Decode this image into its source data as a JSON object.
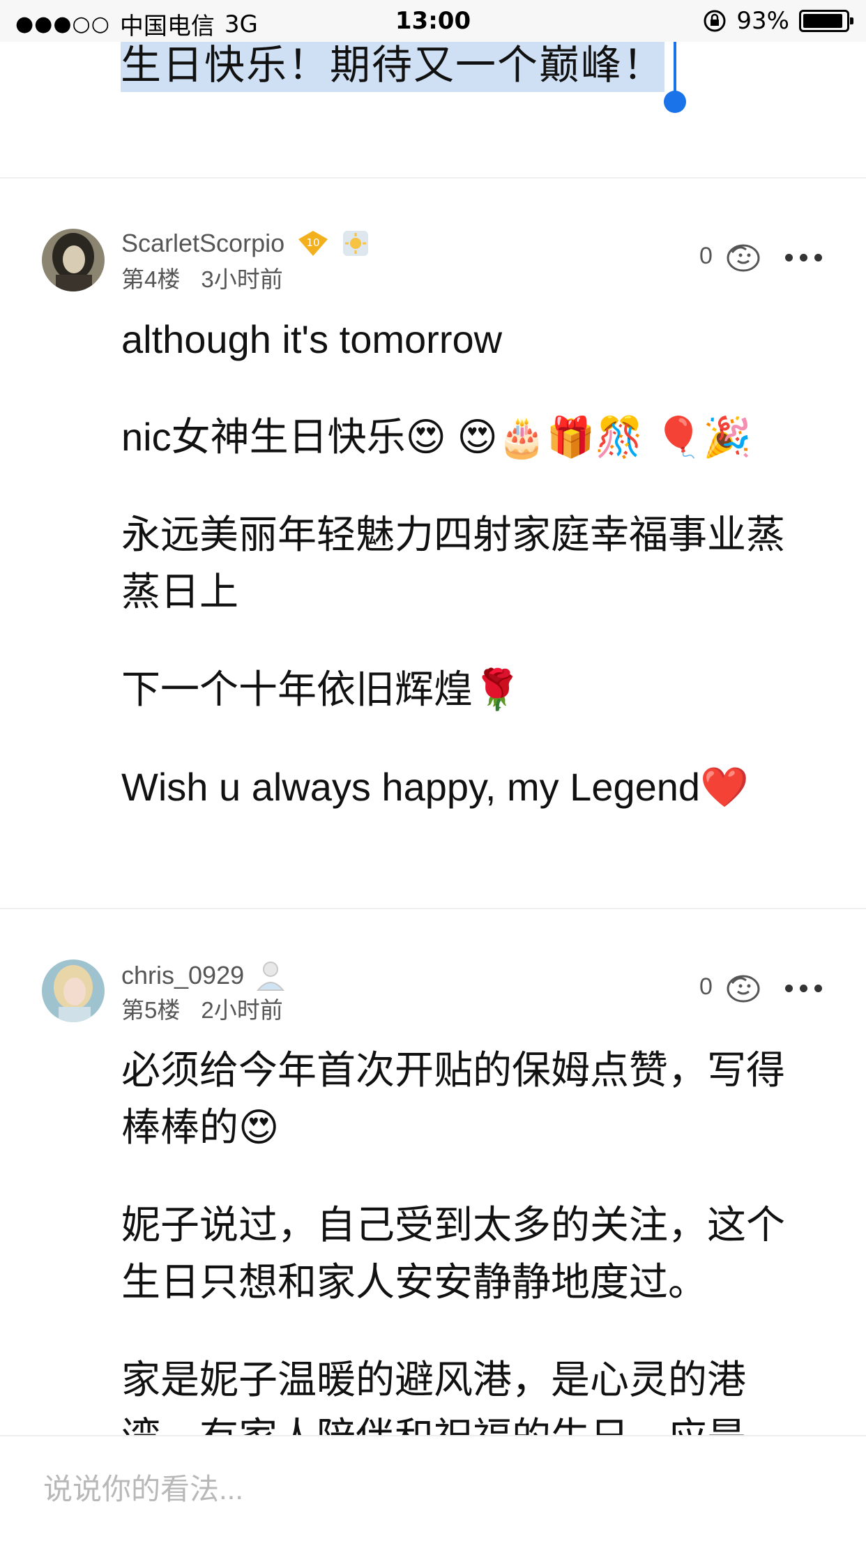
{
  "status_bar": {
    "signal": "●●●○○",
    "carrier": "中国电信",
    "network": "3G",
    "time": "13:00",
    "battery": "93%",
    "battery_level": 0.93
  },
  "selected_text": "生日快乐！期待又一个巅峰！",
  "comments": [
    {
      "username": "ScarletScorpio",
      "level_badge": "10",
      "floor": "第4楼",
      "time_ago": "3小时前",
      "likes": "0",
      "paragraphs": [
        "although it's tomorrow",
        "nic女神生日快乐😍 😍🎂🎁🎊 🎈🎉",
        "永远美丽年轻魅力四射家庭幸福事业蒸蒸日上",
        "下一个十年依旧辉煌🌹",
        "Wish u always happy, my Legend❤️"
      ]
    },
    {
      "username": "chris_0929",
      "floor": "第5楼",
      "time_ago": "2小时前",
      "likes": "0",
      "paragraphs": [
        "必须给今年首次开贴的保姆点赞，写得棒棒的😍",
        "妮子说过，自己受到太多的关注，这个生日只想和家人安安静静地度过。",
        "家是妮子温暖的避风港，是心灵的港湾，有家人陪伴和祝福的生日，应是"
      ]
    }
  ],
  "input": {
    "placeholder": "说说你的看法..."
  }
}
